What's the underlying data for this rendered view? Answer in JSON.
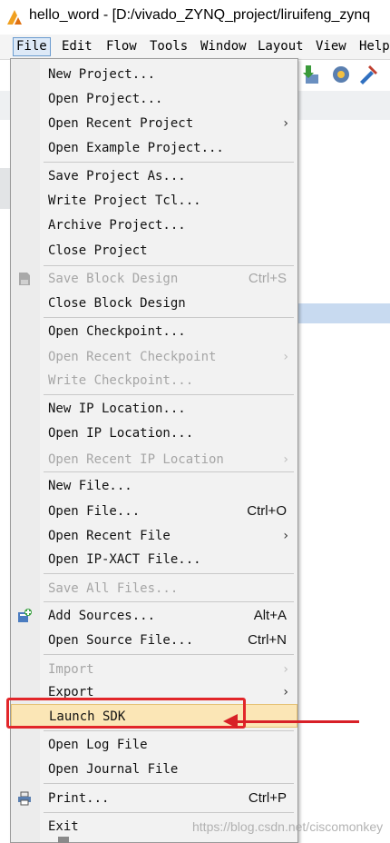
{
  "window": {
    "title": "hello_word - [D:/vivado_ZYNQ_project/liruifeng_zynq"
  },
  "menubar": {
    "items": [
      "File",
      "Edit",
      "Flow",
      "Tools",
      "Window",
      "Layout",
      "View",
      "Help"
    ],
    "active": "File"
  },
  "file_menu": {
    "items": [
      {
        "label": "New Project...",
        "enabled": true
      },
      {
        "label": "Open Project...",
        "enabled": true
      },
      {
        "label": "Open Recent Project",
        "enabled": true,
        "submenu": true
      },
      {
        "label": "Open Example Project...",
        "enabled": true
      },
      {
        "label": "Save Project As...",
        "enabled": true
      },
      {
        "label": "Write Project Tcl...",
        "enabled": true
      },
      {
        "label": "Archive Project...",
        "enabled": true
      },
      {
        "label": "Close Project",
        "enabled": true
      },
      {
        "label": "Save Block Design",
        "enabled": false,
        "shortcut": "Ctrl+S",
        "icon": "save-icon"
      },
      {
        "label": "Close Block Design",
        "enabled": true
      },
      {
        "label": "Open Checkpoint...",
        "enabled": true
      },
      {
        "label": "Open Recent Checkpoint",
        "enabled": false,
        "submenu": true
      },
      {
        "label": "Write Checkpoint...",
        "enabled": false
      },
      {
        "label": "New IP Location...",
        "enabled": true
      },
      {
        "label": "Open IP Location...",
        "enabled": true
      },
      {
        "label": "Open Recent IP Location",
        "enabled": false,
        "submenu": true
      },
      {
        "label": "New File...",
        "enabled": true
      },
      {
        "label": "Open File...",
        "enabled": true,
        "shortcut": "Ctrl+O"
      },
      {
        "label": "Open Recent File",
        "enabled": true,
        "submenu": true
      },
      {
        "label": "Open IP-XACT File...",
        "enabled": true
      },
      {
        "label": "Save All Files...",
        "enabled": false
      },
      {
        "label": "Add Sources...",
        "enabled": true,
        "shortcut": "Alt+A",
        "icon": "add-sources-icon"
      },
      {
        "label": "Open Source File...",
        "enabled": true,
        "shortcut": "Ctrl+N"
      },
      {
        "label": "Import",
        "enabled": false,
        "submenu": true
      },
      {
        "label": "Export",
        "enabled": true,
        "submenu": true
      },
      {
        "label": "Launch SDK",
        "enabled": true,
        "highlighted": true
      },
      {
        "label": "Open Log File",
        "enabled": true
      },
      {
        "label": "Open Journal File",
        "enabled": true
      },
      {
        "label": "Print...",
        "enabled": true,
        "shortcut": "Ctrl+P",
        "icon": "printer-icon"
      },
      {
        "label": "Exit",
        "enabled": true
      }
    ],
    "submenu_arrow": "›"
  },
  "watermark": "https://blog.csdn.net/ciscomonkey",
  "colors": {
    "highlight_bg": "#fbe6b6",
    "annotation_red": "#e2262a",
    "disabled_text": "#a6a6a6"
  }
}
